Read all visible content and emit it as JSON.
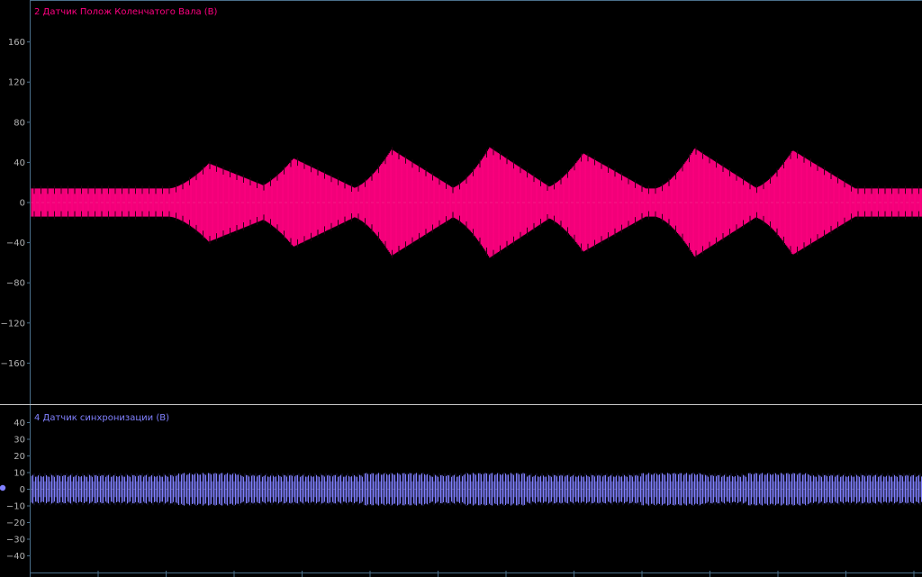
{
  "chart_data": [
    {
      "type": "line",
      "title": "2 Датчик Полож Коленчатого Вала (В)",
      "color": "#ff0080",
      "ylim": [
        -200,
        200
      ],
      "yticks": [
        160,
        120,
        80,
        40,
        0,
        -40,
        -80,
        -120,
        -160
      ],
      "zero_line": true,
      "envelope": {
        "baseline": 14,
        "peaks": [
          {
            "x": 0.2,
            "amp": 39
          },
          {
            "x": 0.295,
            "amp": 44
          },
          {
            "x": 0.405,
            "amp": 53
          },
          {
            "x": 0.515,
            "amp": 55
          },
          {
            "x": 0.62,
            "amp": 49
          },
          {
            "x": 0.745,
            "amp": 54
          },
          {
            "x": 0.855,
            "amp": 52
          }
        ]
      }
    },
    {
      "type": "line",
      "title": "4 Датчик синхронизации (В)",
      "color": "#8080ff",
      "ylim": [
        -50,
        50
      ],
      "yticks": [
        40,
        30,
        20,
        10,
        0,
        -10,
        -20,
        -30,
        -40
      ],
      "zero_line": true,
      "envelope": {
        "baseline": 8,
        "peaks": []
      }
    }
  ],
  "colors": {
    "background": "#000000",
    "frame": "#4a6f8a",
    "divider": "#c8c8c8",
    "axis_text": "#b4b4b4",
    "channel_marker": "#8080ff"
  }
}
